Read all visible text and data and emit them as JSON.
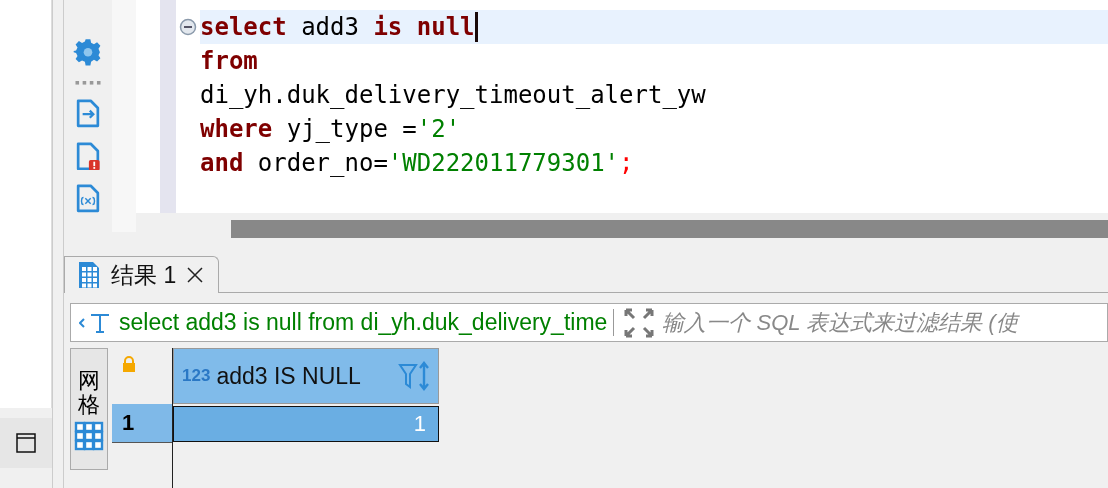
{
  "editor": {
    "lines": [
      {
        "current": true,
        "fold": true,
        "tokens": [
          {
            "kind": "keyword",
            "text": "select"
          },
          {
            "kind": "plain",
            "text": " add3 "
          },
          {
            "kind": "keyword",
            "text": "is null"
          }
        ]
      },
      {
        "current": false,
        "fold": false,
        "tokens": [
          {
            "kind": "keyword",
            "text": "from"
          }
        ]
      },
      {
        "current": false,
        "fold": false,
        "tokens": [
          {
            "kind": "plain",
            "text": "di_yh.duk_delivery_timeout_alert_yw"
          }
        ]
      },
      {
        "current": false,
        "fold": false,
        "tokens": [
          {
            "kind": "keyword",
            "text": "where"
          },
          {
            "kind": "plain",
            "text": " yj_type ="
          },
          {
            "kind": "string",
            "text": "'2'"
          }
        ]
      },
      {
        "current": false,
        "fold": false,
        "tokens": [
          {
            "kind": "keyword",
            "text": "and"
          },
          {
            "kind": "plain",
            "text": " order_no="
          },
          {
            "kind": "string",
            "text": "'WD222011779301'"
          },
          {
            "kind": "punct",
            "text": ";"
          }
        ]
      }
    ]
  },
  "results": {
    "tabs": [
      {
        "label": "结果 1",
        "selected": true
      }
    ],
    "filter": {
      "query": "select add3 is null from di_yh.duk_delivery_time",
      "placeholder": "输入一个 SQL 表达式来过滤结果 (使"
    },
    "side_tab": {
      "label": "网格"
    },
    "columns": [
      {
        "type": "123",
        "name": "add3 IS NULL"
      }
    ],
    "rows": [
      {
        "number": "1",
        "selected": true,
        "cells": [
          "1"
        ]
      }
    ]
  }
}
